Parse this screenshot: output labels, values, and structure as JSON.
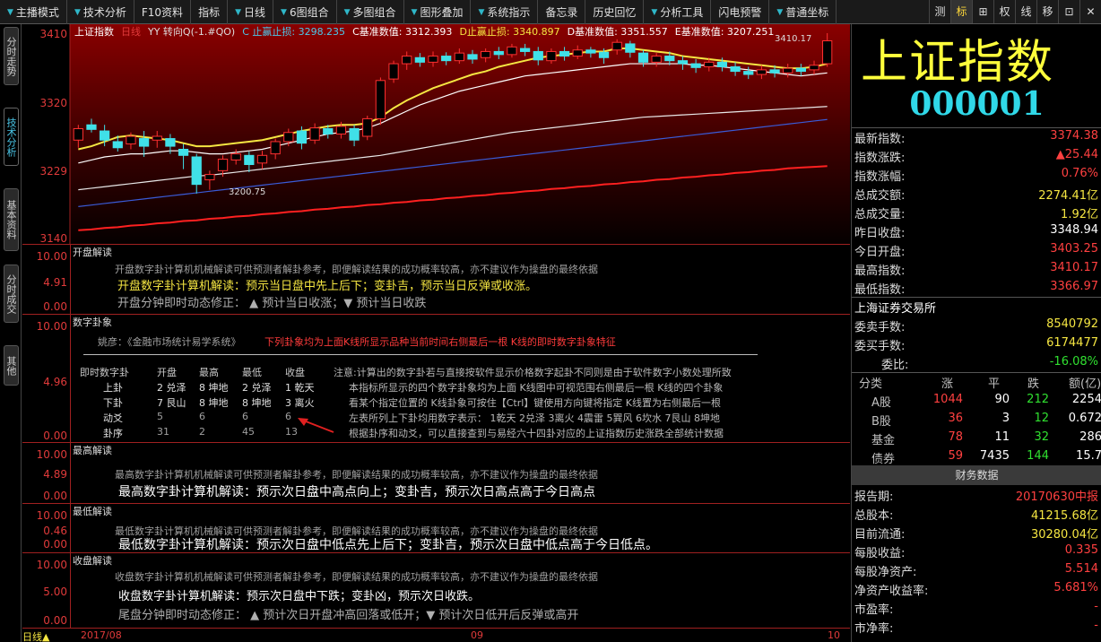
{
  "toolbar": {
    "items": [
      {
        "label": "主播模式",
        "arrow": true
      },
      {
        "label": "技术分析",
        "arrow": true
      },
      {
        "label": "F10资料",
        "arrow": false
      },
      {
        "label": "指标",
        "arrow": false
      },
      {
        "label": "日线",
        "arrow": true
      },
      {
        "label": "6图组合",
        "arrow": true
      },
      {
        "label": "多图组合",
        "arrow": true
      },
      {
        "label": "图形叠加",
        "arrow": true
      },
      {
        "label": "系统指示",
        "arrow": true
      },
      {
        "label": "备忘录",
        "arrow": false
      },
      {
        "label": "历史回忆",
        "arrow": false
      },
      {
        "label": "分析工具",
        "arrow": true
      },
      {
        "label": "闪电预警",
        "arrow": false
      },
      {
        "label": "普通坐标",
        "arrow": true
      }
    ],
    "right_buttons": [
      "测",
      "标",
      "⊞",
      "权",
      "线",
      "移",
      "⊡",
      "✕"
    ]
  },
  "left_tabs": [
    "分时走势",
    "技术分析",
    "基本资料",
    "分时成交",
    "其他"
  ],
  "chart": {
    "legend": [
      {
        "text": "上证指数",
        "color": "#ffffff"
      },
      {
        "text": "日线",
        "color": "#e03a3a"
      },
      {
        "text": "YY 转向Q(-1.#QO)",
        "color": "#dddddd"
      },
      {
        "text": "C 止赢止损: 3298.235",
        "color": "#4bc8ea"
      },
      {
        "text": "C基准数值: 3312.393",
        "color": "#ffffff"
      },
      {
        "text": "D止赢止损: 3340.897",
        "color": "#f5e642"
      },
      {
        "text": "D基准数值: 3351.557",
        "color": "#ffffff"
      },
      {
        "text": "E基准数值: 3207.251",
        "color": "#ffffff"
      }
    ],
    "y_ticks": [
      "3410",
      "3320",
      "3229",
      "3140"
    ],
    "annotations": {
      "high": "3410.17",
      "low": "3200.75"
    }
  },
  "chart_data": {
    "type": "candlestick",
    "title": "上证指数 日线",
    "ylim": [
      3140,
      3410
    ],
    "y_ticks": [
      3410,
      3320,
      3229,
      3140
    ],
    "x_labels": [
      "2017/08",
      "09",
      "10"
    ],
    "candles": [
      [
        3270,
        3285,
        3260,
        3290
      ],
      [
        3290,
        3284,
        3280,
        3298
      ],
      [
        3282,
        3270,
        3262,
        3290
      ],
      [
        3268,
        3260,
        3255,
        3276
      ],
      [
        3265,
        3275,
        3258,
        3280
      ],
      [
        3272,
        3262,
        3248,
        3282
      ],
      [
        3270,
        3275,
        3260,
        3282
      ],
      [
        3272,
        3262,
        3252,
        3278
      ],
      [
        3258,
        3250,
        3232,
        3265
      ],
      [
        3248,
        3212,
        3200,
        3252
      ],
      [
        3218,
        3225,
        3205,
        3230
      ],
      [
        3230,
        3245,
        3222,
        3250
      ],
      [
        3244,
        3252,
        3238,
        3258
      ],
      [
        3250,
        3238,
        3228,
        3255
      ],
      [
        3240,
        3250,
        3232,
        3256
      ],
      [
        3252,
        3268,
        3245,
        3272
      ],
      [
        3268,
        3280,
        3262,
        3285
      ],
      [
        3282,
        3266,
        3258,
        3288
      ],
      [
        3270,
        3286,
        3265,
        3292
      ],
      [
        3285,
        3278,
        3272,
        3290
      ],
      [
        3278,
        3288,
        3272,
        3294
      ],
      [
        3285,
        3270,
        3262,
        3290
      ],
      [
        3275,
        3298,
        3270,
        3302
      ],
      [
        3298,
        3348,
        3290,
        3352
      ],
      [
        3350,
        3370,
        3345,
        3374
      ],
      [
        3370,
        3380,
        3362,
        3386
      ],
      [
        3378,
        3372,
        3366,
        3384
      ],
      [
        3372,
        3380,
        3366,
        3386
      ],
      [
        3380,
        3374,
        3368,
        3385
      ],
      [
        3374,
        3384,
        3370,
        3390
      ],
      [
        3382,
        3376,
        3370,
        3388
      ],
      [
        3378,
        3386,
        3372,
        3390
      ],
      [
        3386,
        3382,
        3376,
        3392
      ],
      [
        3382,
        3392,
        3378,
        3396
      ],
      [
        3390,
        3386,
        3380,
        3396
      ],
      [
        3386,
        3375,
        3368,
        3392
      ],
      [
        3374,
        3386,
        3370,
        3390
      ],
      [
        3386,
        3380,
        3374,
        3392
      ],
      [
        3380,
        3388,
        3376,
        3394
      ],
      [
        3388,
        3384,
        3378,
        3392
      ],
      [
        3385,
        3378,
        3370,
        3390
      ],
      [
        3388,
        3398,
        3382,
        3402
      ],
      [
        3396,
        3385,
        3378,
        3400
      ],
      [
        3384,
        3372,
        3366,
        3388
      ],
      [
        3372,
        3380,
        3366,
        3384
      ],
      [
        3380,
        3374,
        3368,
        3386
      ],
      [
        3374,
        3370,
        3362,
        3380
      ],
      [
        3370,
        3365,
        3358,
        3376
      ],
      [
        3366,
        3372,
        3360,
        3378
      ],
      [
        3372,
        3366,
        3360,
        3378
      ],
      [
        3366,
        3360,
        3354,
        3372
      ],
      [
        3360,
        3356,
        3350,
        3366
      ],
      [
        3356,
        3362,
        3350,
        3368
      ],
      [
        3362,
        3358,
        3352,
        3368
      ],
      [
        3358,
        3364,
        3352,
        3370
      ],
      [
        3364,
        3360,
        3354,
        3370
      ],
      [
        3362,
        3368,
        3356,
        3374
      ],
      [
        3370,
        3400,
        3366,
        3410
      ]
    ],
    "series": [
      {
        "color": "#f5e642",
        "values": [
          3258,
          3262,
          3268,
          3274,
          3276,
          3274,
          3272,
          3270,
          3266,
          3262,
          3262,
          3264,
          3266,
          3268,
          3270,
          3274,
          3278,
          3282,
          3285,
          3288,
          3290,
          3290,
          3292,
          3300,
          3312,
          3322,
          3330,
          3338,
          3344,
          3350,
          3356,
          3360,
          3366,
          3370,
          3374,
          3378,
          3380,
          3382,
          3384,
          3386,
          3386,
          3390,
          3390,
          3388,
          3386,
          3384,
          3380,
          3378,
          3376,
          3374,
          3372,
          3370,
          3368,
          3366,
          3364,
          3364,
          3366,
          3370
        ]
      },
      {
        "color": "#ffffff",
        "values": [
          3240,
          3244,
          3248,
          3250,
          3252,
          3252,
          3254,
          3256,
          3256,
          3254,
          3252,
          3252,
          3254,
          3256,
          3258,
          3262,
          3266,
          3270,
          3274,
          3278,
          3280,
          3282,
          3286,
          3292,
          3300,
          3308,
          3316,
          3322,
          3328,
          3334,
          3338,
          3342,
          3346,
          3350,
          3354,
          3356,
          3358,
          3360,
          3362,
          3364,
          3366,
          3368,
          3370,
          3370,
          3370,
          3370,
          3370,
          3368,
          3368,
          3366,
          3364,
          3362,
          3360,
          3358,
          3356,
          3354,
          3356,
          3358
        ]
      },
      {
        "color": "#e8e8e8",
        "values": [
          3205,
          3207,
          3209,
          3211,
          3213,
          3215,
          3217,
          3219,
          3221,
          3223,
          3224,
          3226,
          3228,
          3230,
          3232,
          3234,
          3236,
          3238,
          3240,
          3242,
          3244,
          3246,
          3248,
          3250,
          3253,
          3256,
          3259,
          3262,
          3265,
          3268,
          3271,
          3274,
          3277,
          3280,
          3282,
          3284,
          3286,
          3288,
          3290,
          3292,
          3294,
          3296,
          3298,
          3300,
          3301,
          3302,
          3303,
          3304,
          3305,
          3306,
          3307,
          3308,
          3309,
          3310,
          3311,
          3312,
          3313,
          3314
        ]
      },
      {
        "color": "#3a5bd8",
        "values": [
          3183,
          3185,
          3187,
          3189,
          3191,
          3193,
          3195,
          3197,
          3199,
          3201,
          3203,
          3205,
          3207,
          3209,
          3211,
          3213,
          3215,
          3217,
          3219,
          3221,
          3223,
          3225,
          3227,
          3229,
          3231,
          3233,
          3235,
          3237,
          3239,
          3241,
          3243,
          3245,
          3247,
          3249,
          3251,
          3253,
          3255,
          3257,
          3259,
          3261,
          3263,
          3265,
          3267,
          3269,
          3271,
          3273,
          3275,
          3277,
          3279,
          3281,
          3283,
          3285,
          3287,
          3289,
          3291,
          3293,
          3295,
          3297
        ]
      },
      {
        "color": "#ff2020",
        "values": [
          3152,
          3153,
          3155,
          3156,
          3158,
          3159,
          3161,
          3162,
          3164,
          3165,
          3167,
          3168,
          3170,
          3171,
          3173,
          3174,
          3176,
          3177,
          3179,
          3180,
          3182,
          3183,
          3185,
          3186,
          3188,
          3189,
          3191,
          3192,
          3194,
          3195,
          3197,
          3198,
          3200,
          3201,
          3203,
          3204,
          3206,
          3207,
          3209,
          3210,
          3212,
          3213,
          3215,
          3216,
          3218,
          3219,
          3221,
          3222,
          3224,
          3225,
          3227,
          3228,
          3230,
          3231,
          3233,
          3234,
          3235,
          3236
        ]
      }
    ]
  },
  "panels": {
    "open": {
      "title": "开盘解读",
      "axis": [
        "10.00",
        "4.91",
        "0.00"
      ],
      "desc": "开盘数字卦计算机机械解读可供预测者解卦参考，即便解读结果的成功概率较高，亦不建议作为操盘的最终依据",
      "reading": "开盘数字卦计算机解读：预示当日盘中先上后下；变卦吉，预示当日反弹或收涨。",
      "dynamic": "开盘分钟即时动态修正：  ▲ 预计当日收涨；▼ 预计当日收跌"
    },
    "gua": {
      "title": "数字卦象",
      "axis": [
        "10.00",
        "4.96",
        "0.00"
      ],
      "source": "姚彦：《金融市场统计易学系统》",
      "source_note": "下列卦象均为上面K线所显示品种当前时间右侧最后一根 K线的即时数字卦象特征",
      "headers": [
        "即时数字卦",
        "开盘",
        "最高",
        "最低",
        "收盘"
      ],
      "rows": [
        [
          "上卦",
          "2 兑泽",
          "8 坤地",
          "2 兑泽",
          "1 乾天"
        ],
        [
          "下卦",
          "7 艮山",
          "8 坤地",
          "8 坤地",
          "3 离火"
        ],
        [
          "动爻",
          "5",
          "6",
          "6",
          "6"
        ],
        [
          "卦序",
          "31",
          "2",
          "45",
          "13"
        ]
      ],
      "notes": [
        "注意:计算出的数字卦若与直接按软件显示价格数字起卦不同则是由于软件数字小数处理所致",
        "本指标所显示的四个数字卦象均为上面 K线图中可视范围右侧最后一根 K线的四个卦象",
        "看某个指定位置的 K线卦象可按住【Ctrl】键使用方向键将指定 K线置为右侧最后一根",
        "左表所列上下卦均用数字表示：  1乾天 2兑泽 3离火 4震雷 5巽风 6坎水 7艮山 8坤地",
        "根据卦序和动爻，可以直接查到与易经六十四卦对应的上证指数历史涨跌全部统计数据"
      ]
    },
    "high": {
      "title": "最高解读",
      "axis": [
        "10.00",
        "4.89",
        "0.00"
      ],
      "desc": "最高数字卦计算机机械解读可供预测者解卦参考，即便解读结果的成功概率较高，亦不建议作为操盘的最终依据",
      "reading": "最高数字卦计算机解读：预示次日盘中高点向上；变卦吉，预示次日高点高于今日高点"
    },
    "low": {
      "title": "最低解读",
      "axis": [
        "10.00",
        "0.46",
        "0.00"
      ],
      "desc": "最低数字卦计算机机械解读可供预测者解卦参考，即便解读结果的成功概率较高，亦不建议作为操盘的最终依据",
      "reading": "最低数字卦计算机解读：预示次日盘中低点先上后下；变卦吉，预示次日盘中低点高于今日低点。"
    },
    "close": {
      "title": "收盘解读",
      "axis": [
        "10.00",
        "5.00",
        "0.00"
      ],
      "desc": "收盘数字卦计算机机械解读可供预测者解卦参考，即便解读结果的成功概率较高，亦不建议作为操盘的最终依据",
      "reading": "收盘数字卦计算机解读：预示次日盘中下跌；变卦凶，预示次日收跌。",
      "dynamic": "尾盘分钟即时动态修正：  ▲ 预计次日开盘冲高回落或低开；▼ 预计次日低开后反弹或高开"
    }
  },
  "bottom": {
    "period": "日线▲",
    "dates": [
      "2017/08",
      "09",
      "10"
    ]
  },
  "right": {
    "name": "上证指数",
    "code": "000001",
    "quote": [
      {
        "k": "最新指数:",
        "v": "3374.38",
        "c": "red"
      },
      {
        "k": "指数涨跌:",
        "v": "▲25.44",
        "c": "red"
      },
      {
        "k": "指数涨幅:",
        "v": "0.76%",
        "c": "red"
      },
      {
        "k": "总成交额:",
        "v": "2274.41亿",
        "c": "yel"
      },
      {
        "k": "总成交量:",
        "v": "1.92亿",
        "c": "yel"
      },
      {
        "k": "昨日收盘:",
        "v": "3348.94",
        "c": "wht"
      },
      {
        "k": "今日开盘:",
        "v": "3403.25",
        "c": "red"
      },
      {
        "k": "最高指数:",
        "v": "3410.17",
        "c": "red"
      },
      {
        "k": "最低指数:",
        "v": "3366.97",
        "c": "red"
      }
    ],
    "exchange": "上海证券交易所",
    "orders": [
      {
        "k": "委卖手数:",
        "v": "8540792",
        "c": "yel"
      },
      {
        "k": "委买手数:",
        "v": "6174477",
        "c": "yel"
      },
      {
        "k": "委比:",
        "v": "-16.08%",
        "c": "grn"
      }
    ],
    "cat_headers": [
      "分类",
      "涨",
      "平",
      "跌",
      "额(亿)"
    ],
    "cat_rows": [
      [
        "A股",
        "1044",
        "90",
        "212",
        "2254"
      ],
      [
        "B股",
        "36",
        "3",
        "12",
        "0.672"
      ],
      [
        "基金",
        "78",
        "11",
        "32",
        "286"
      ],
      [
        "债券",
        "59",
        "7435",
        "144",
        "15.7"
      ]
    ],
    "fin_title": "财务数据",
    "fin": [
      {
        "k": "报告期:",
        "v": "20170630中报",
        "c": "red"
      },
      {
        "k": "总股本:",
        "v": "41215.68亿",
        "c": "yel"
      },
      {
        "k": "目前流通:",
        "v": "30280.04亿",
        "c": "yel"
      },
      {
        "k": "每股收益:",
        "v": "0.335",
        "c": "red"
      },
      {
        "k": "每股净资产:",
        "v": "5.514",
        "c": "red"
      },
      {
        "k": "净资产收益率:",
        "v": "5.681%",
        "c": "red"
      },
      {
        "k": "市盈率:",
        "v": "-",
        "c": "red"
      },
      {
        "k": "市净率:",
        "v": "-",
        "c": "red"
      }
    ]
  }
}
